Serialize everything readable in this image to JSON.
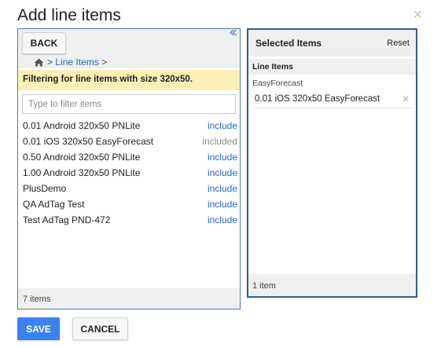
{
  "dialog": {
    "title": "Add line items",
    "close_glyph": "×"
  },
  "left": {
    "back_label": "BACK",
    "breadcrumb_link": "Line Items",
    "breadcrumb_sep_before": ">",
    "breadcrumb_sep_after": ">",
    "filter_banner": "Filtering for line items with size 320x50.",
    "filter_placeholder": "Type to filter items",
    "items": [
      {
        "name": "0.01 Android 320x50 PNLite",
        "action": "include"
      },
      {
        "name": "0.01 iOS 320x50 EasyForecast",
        "action": "included"
      },
      {
        "name": "0.50 Android 320x50 PNLite",
        "action": "include"
      },
      {
        "name": "1.00 Android 320x50 PNLite",
        "action": "include"
      },
      {
        "name": "PlusDemo",
        "action": "include"
      },
      {
        "name": "QA AdTag Test",
        "action": "include"
      },
      {
        "name": "Test AdTag PND-472",
        "action": "include"
      }
    ],
    "footer_count": "7 items"
  },
  "right": {
    "title": "Selected Items",
    "reset_label": "Reset",
    "section_label": "Line Items",
    "group_label": "EasyForecast",
    "selected": [
      {
        "name": "0.01 iOS 320x50 EasyForecast"
      }
    ],
    "footer_count": "1 item"
  },
  "buttons": {
    "save_label": "SAVE",
    "cancel_label": "CANCEL"
  },
  "colors": {
    "accent": "#3b82f0",
    "link": "#2a66c4",
    "panel_border": "#4f7bb6",
    "highlight": "#fbefb6"
  },
  "icons": {
    "home": "home-icon",
    "close": "close-icon",
    "collapse": "collapse-icon",
    "remove": "remove-icon"
  }
}
